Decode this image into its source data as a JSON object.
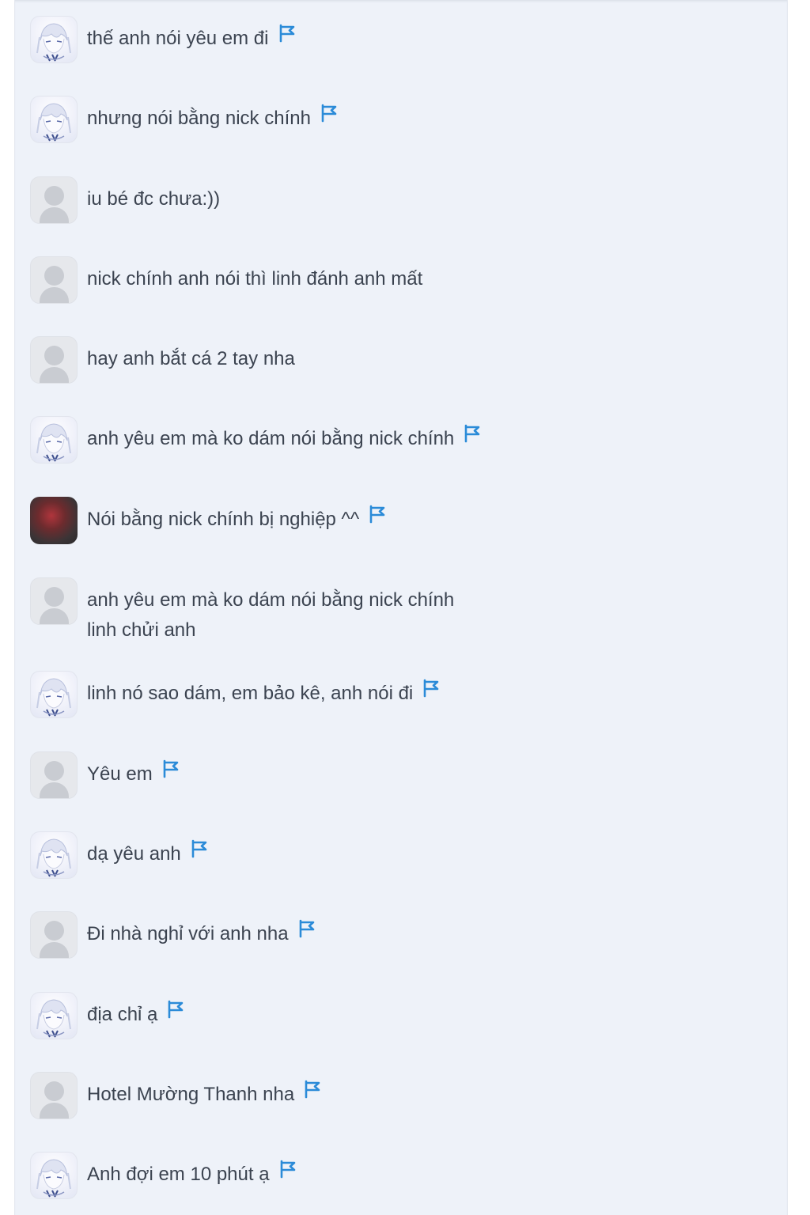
{
  "colors": {
    "panel_bg": "#eef2f9",
    "text": "#3b4350",
    "flag": "#2b8bd8"
  },
  "icons": {
    "flag": "flag-icon",
    "default_avatar": "user-icon"
  },
  "messages": [
    {
      "avatar": "anime",
      "text": "thế anh nói yêu em đi",
      "flag": true
    },
    {
      "avatar": "anime",
      "text": "nhưng nói bằng nick chính",
      "flag": true
    },
    {
      "avatar": "default",
      "text": "iu bé đc chưa:))",
      "flag": false
    },
    {
      "avatar": "default",
      "text": "nick chính anh nói thì linh đánh anh mất",
      "flag": false
    },
    {
      "avatar": "default",
      "text": "hay anh bắt cá 2 tay nha",
      "flag": false
    },
    {
      "avatar": "anime",
      "text": "anh yêu em mà ko dám nói bằng nick chính",
      "flag": true
    },
    {
      "avatar": "dark",
      "text": "Nói bằng nick chính bị nghiệp ^^",
      "flag": true
    },
    {
      "avatar": "default",
      "text": "anh yêu em mà ko dám nói bằng nick chính",
      "text2": "linh chửi anh",
      "flag": false
    },
    {
      "avatar": "anime",
      "text": "linh nó sao dám, em bảo kê, anh nói đi",
      "flag": true
    },
    {
      "avatar": "default",
      "text": "Yêu em",
      "flag": true
    },
    {
      "avatar": "anime",
      "text": "dạ yêu anh",
      "flag": true
    },
    {
      "avatar": "default",
      "text": "Đi nhà nghỉ với anh nha",
      "flag": true
    },
    {
      "avatar": "anime",
      "text": "địa chỉ ạ",
      "flag": true
    },
    {
      "avatar": "default",
      "text": "Hotel Mường Thanh nha",
      "flag": true
    },
    {
      "avatar": "anime",
      "text": "Anh đợi em 10 phút ạ",
      "flag": true
    }
  ]
}
